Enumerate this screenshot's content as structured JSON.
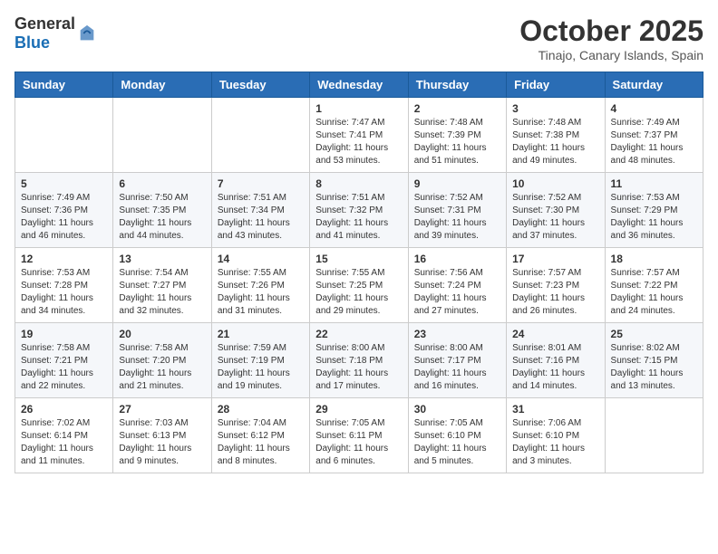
{
  "header": {
    "logo_general": "General",
    "logo_blue": "Blue",
    "month_title": "October 2025",
    "location": "Tinajo, Canary Islands, Spain"
  },
  "days_of_week": [
    "Sunday",
    "Monday",
    "Tuesday",
    "Wednesday",
    "Thursday",
    "Friday",
    "Saturday"
  ],
  "weeks": [
    [
      {
        "day": "",
        "content": ""
      },
      {
        "day": "",
        "content": ""
      },
      {
        "day": "",
        "content": ""
      },
      {
        "day": "1",
        "content": "Sunrise: 7:47 AM\nSunset: 7:41 PM\nDaylight: 11 hours\nand 53 minutes."
      },
      {
        "day": "2",
        "content": "Sunrise: 7:48 AM\nSunset: 7:39 PM\nDaylight: 11 hours\nand 51 minutes."
      },
      {
        "day": "3",
        "content": "Sunrise: 7:48 AM\nSunset: 7:38 PM\nDaylight: 11 hours\nand 49 minutes."
      },
      {
        "day": "4",
        "content": "Sunrise: 7:49 AM\nSunset: 7:37 PM\nDaylight: 11 hours\nand 48 minutes."
      }
    ],
    [
      {
        "day": "5",
        "content": "Sunrise: 7:49 AM\nSunset: 7:36 PM\nDaylight: 11 hours\nand 46 minutes."
      },
      {
        "day": "6",
        "content": "Sunrise: 7:50 AM\nSunset: 7:35 PM\nDaylight: 11 hours\nand 44 minutes."
      },
      {
        "day": "7",
        "content": "Sunrise: 7:51 AM\nSunset: 7:34 PM\nDaylight: 11 hours\nand 43 minutes."
      },
      {
        "day": "8",
        "content": "Sunrise: 7:51 AM\nSunset: 7:32 PM\nDaylight: 11 hours\nand 41 minutes."
      },
      {
        "day": "9",
        "content": "Sunrise: 7:52 AM\nSunset: 7:31 PM\nDaylight: 11 hours\nand 39 minutes."
      },
      {
        "day": "10",
        "content": "Sunrise: 7:52 AM\nSunset: 7:30 PM\nDaylight: 11 hours\nand 37 minutes."
      },
      {
        "day": "11",
        "content": "Sunrise: 7:53 AM\nSunset: 7:29 PM\nDaylight: 11 hours\nand 36 minutes."
      }
    ],
    [
      {
        "day": "12",
        "content": "Sunrise: 7:53 AM\nSunset: 7:28 PM\nDaylight: 11 hours\nand 34 minutes."
      },
      {
        "day": "13",
        "content": "Sunrise: 7:54 AM\nSunset: 7:27 PM\nDaylight: 11 hours\nand 32 minutes."
      },
      {
        "day": "14",
        "content": "Sunrise: 7:55 AM\nSunset: 7:26 PM\nDaylight: 11 hours\nand 31 minutes."
      },
      {
        "day": "15",
        "content": "Sunrise: 7:55 AM\nSunset: 7:25 PM\nDaylight: 11 hours\nand 29 minutes."
      },
      {
        "day": "16",
        "content": "Sunrise: 7:56 AM\nSunset: 7:24 PM\nDaylight: 11 hours\nand 27 minutes."
      },
      {
        "day": "17",
        "content": "Sunrise: 7:57 AM\nSunset: 7:23 PM\nDaylight: 11 hours\nand 26 minutes."
      },
      {
        "day": "18",
        "content": "Sunrise: 7:57 AM\nSunset: 7:22 PM\nDaylight: 11 hours\nand 24 minutes."
      }
    ],
    [
      {
        "day": "19",
        "content": "Sunrise: 7:58 AM\nSunset: 7:21 PM\nDaylight: 11 hours\nand 22 minutes."
      },
      {
        "day": "20",
        "content": "Sunrise: 7:58 AM\nSunset: 7:20 PM\nDaylight: 11 hours\nand 21 minutes."
      },
      {
        "day": "21",
        "content": "Sunrise: 7:59 AM\nSunset: 7:19 PM\nDaylight: 11 hours\nand 19 minutes."
      },
      {
        "day": "22",
        "content": "Sunrise: 8:00 AM\nSunset: 7:18 PM\nDaylight: 11 hours\nand 17 minutes."
      },
      {
        "day": "23",
        "content": "Sunrise: 8:00 AM\nSunset: 7:17 PM\nDaylight: 11 hours\nand 16 minutes."
      },
      {
        "day": "24",
        "content": "Sunrise: 8:01 AM\nSunset: 7:16 PM\nDaylight: 11 hours\nand 14 minutes."
      },
      {
        "day": "25",
        "content": "Sunrise: 8:02 AM\nSunset: 7:15 PM\nDaylight: 11 hours\nand 13 minutes."
      }
    ],
    [
      {
        "day": "26",
        "content": "Sunrise: 7:02 AM\nSunset: 6:14 PM\nDaylight: 11 hours\nand 11 minutes."
      },
      {
        "day": "27",
        "content": "Sunrise: 7:03 AM\nSunset: 6:13 PM\nDaylight: 11 hours\nand 9 minutes."
      },
      {
        "day": "28",
        "content": "Sunrise: 7:04 AM\nSunset: 6:12 PM\nDaylight: 11 hours\nand 8 minutes."
      },
      {
        "day": "29",
        "content": "Sunrise: 7:05 AM\nSunset: 6:11 PM\nDaylight: 11 hours\nand 6 minutes."
      },
      {
        "day": "30",
        "content": "Sunrise: 7:05 AM\nSunset: 6:10 PM\nDaylight: 11 hours\nand 5 minutes."
      },
      {
        "day": "31",
        "content": "Sunrise: 7:06 AM\nSunset: 6:10 PM\nDaylight: 11 hours\nand 3 minutes."
      },
      {
        "day": "",
        "content": ""
      }
    ]
  ]
}
